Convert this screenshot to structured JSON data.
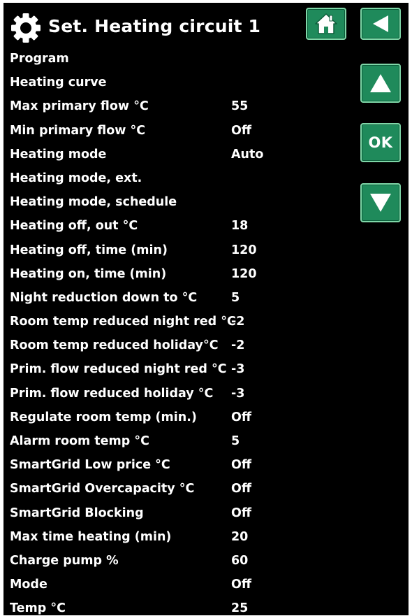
{
  "header": {
    "title": "Set. Heating circuit 1",
    "icon": "gear-icon"
  },
  "nav_buttons": {
    "home_icon": "home-icon",
    "back_icon": "back-arrow-icon",
    "up_icon": "up-arrow-icon",
    "ok_label": "OK",
    "down_icon": "down-arrow-icon"
  },
  "colors": {
    "background": "#000000",
    "text": "#ffffff",
    "button_fill": "#1f8a5b",
    "button_border": "#7fd7a8"
  },
  "settings": [
    {
      "label": "Program",
      "value": ""
    },
    {
      "label": "Heating curve",
      "value": ""
    },
    {
      "label": "Max primary flow °C",
      "value": "55"
    },
    {
      "label": "Min primary flow °C",
      "value": "Off"
    },
    {
      "label": "Heating mode",
      "value": "Auto"
    },
    {
      "label": "Heating mode, ext.",
      "value": ""
    },
    {
      "label": "Heating mode, schedule",
      "value": ""
    },
    {
      "label": "Heating off, out °C",
      "value": "18"
    },
    {
      "label": "Heating off, time (min)",
      "value": "120"
    },
    {
      "label": "Heating on, time (min)",
      "value": "120"
    },
    {
      "label": "Night reduction down to °C",
      "value": "5"
    },
    {
      "label": "Room temp reduced night red °C",
      "value": "-2"
    },
    {
      "label": "Room temp reduced holiday°C",
      "value": "-2"
    },
    {
      "label": "Prim. flow reduced night red °C",
      "value": "-3"
    },
    {
      "label": "Prim. flow reduced holiday °C",
      "value": "-3"
    },
    {
      "label": "Regulate room temp (min.)",
      "value": "Off"
    },
    {
      "label": "Alarm room temp °C",
      "value": "5"
    },
    {
      "label": "SmartGrid Low price °C",
      "value": "Off"
    },
    {
      "label": "SmartGrid Overcapacity °C",
      "value": "Off"
    },
    {
      "label": "SmartGrid Blocking",
      "value": "Off"
    },
    {
      "label": "Max time heating (min)",
      "value": "20"
    },
    {
      "label": "Charge pump %",
      "value": "60"
    },
    {
      "label": "Mode",
      "value": "Off"
    },
    {
      "label": "Temp °C",
      "value": "25"
    }
  ]
}
